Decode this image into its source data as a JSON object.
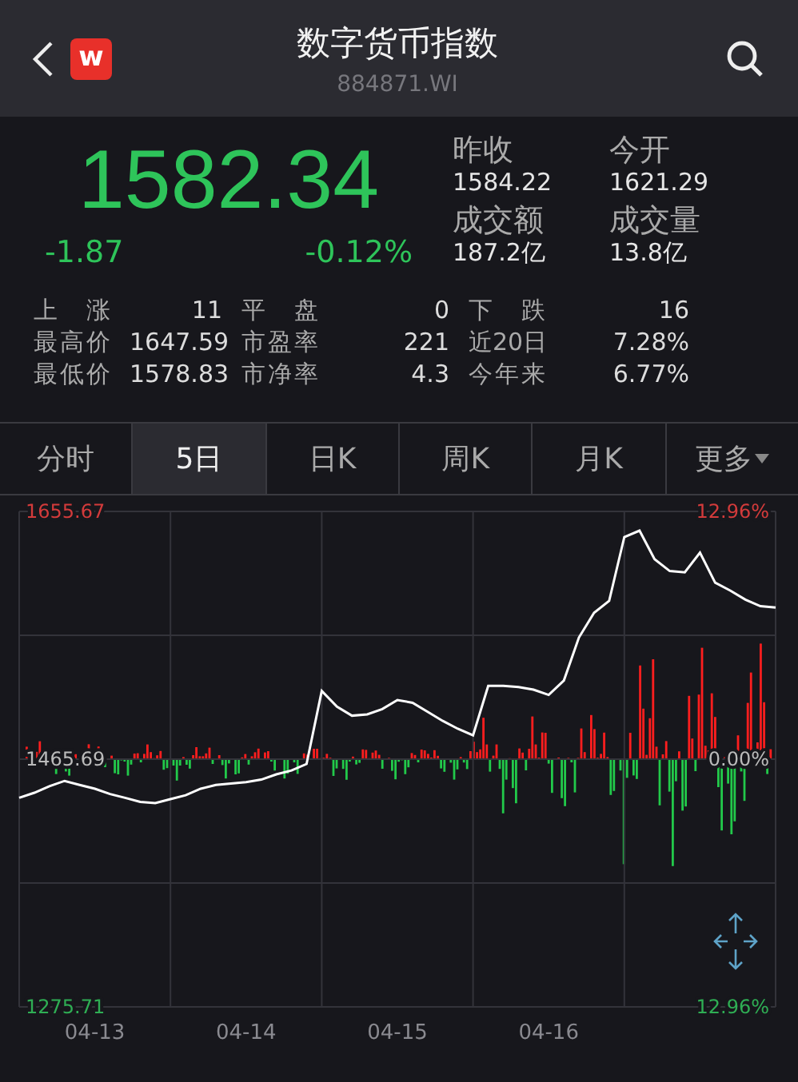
{
  "header": {
    "logo_text": "w",
    "title": "数字货币指数",
    "code": "884871.WI"
  },
  "quote": {
    "price": "1582.34",
    "change": "-1.87",
    "change_pct": "-0.12%",
    "details": [
      {
        "label": "昨收",
        "value": "1584.22"
      },
      {
        "label": "今开",
        "value": "1621.29"
      },
      {
        "label": "成交额",
        "value": "187.2亿"
      },
      {
        "label": "成交量",
        "value": "13.8亿"
      }
    ]
  },
  "stats": [
    [
      {
        "label": "上 涨",
        "value": "11"
      },
      {
        "label": "平 盘",
        "value": "0"
      },
      {
        "label": "下 跌",
        "value": "16"
      }
    ],
    [
      {
        "label": "最高价",
        "value": "1647.59"
      },
      {
        "label": "市盈率",
        "value": "221"
      },
      {
        "label": "近20日",
        "value": "7.28%"
      }
    ],
    [
      {
        "label": "最低价",
        "value": "1578.83"
      },
      {
        "label": "市净率",
        "value": "4.3"
      },
      {
        "label": "今年来",
        "value": "6.77%"
      }
    ]
  ],
  "tabs": [
    {
      "label": "分时",
      "selected": false
    },
    {
      "label": "5日",
      "selected": true
    },
    {
      "label": "日K",
      "selected": false
    },
    {
      "label": "周K",
      "selected": false
    },
    {
      "label": "月K",
      "selected": false
    },
    {
      "label": "更多",
      "selected": false,
      "dropdown": true
    }
  ],
  "chart": {
    "percent_labels": [
      "12.96%",
      "0.00%",
      "12.96%"
    ],
    "chart_data": {
      "type": "line",
      "grid": true,
      "categories": [
        null,
        null,
        null,
        null,
        null,
        "04-13",
        null,
        null,
        null,
        null,
        null,
        null,
        null,
        null,
        null,
        "04-14",
        null,
        null,
        null,
        null,
        null,
        null,
        null,
        null,
        null,
        "04-15",
        null,
        null,
        null,
        null,
        null,
        null,
        null,
        null,
        null,
        "04-16",
        null,
        null,
        null,
        null,
        null,
        null,
        null,
        null,
        null,
        null,
        null,
        null,
        null,
        null,
        null
      ],
      "series": [
        {
          "color": "#ffffff",
          "values": [
            1436,
            1440,
            1445,
            1449,
            1446,
            1443,
            1439,
            1436,
            1433,
            1432,
            1435,
            1438,
            1443,
            1446,
            1447,
            1448,
            1450,
            1454,
            1457,
            1462,
            1518,
            1506,
            1499,
            1500,
            1504,
            1511,
            1509,
            1502,
            1495,
            1489,
            1484,
            1522,
            1522,
            1521,
            1519,
            1515,
            1526,
            1559,
            1578,
            1587,
            1636,
            1641,
            1619,
            1610,
            1609,
            1624,
            1601,
            1595,
            1588,
            1583,
            1582
          ]
        }
      ],
      "ylim": [
        1275.71,
        1655.67
      ],
      "yticks": [
        {
          "value": 1655.67,
          "label": "1655.67"
        },
        {
          "value": 1465.69,
          "label": "1465.69"
        },
        {
          "value": 1275.71,
          "label": "1275.71"
        }
      ]
    }
  }
}
